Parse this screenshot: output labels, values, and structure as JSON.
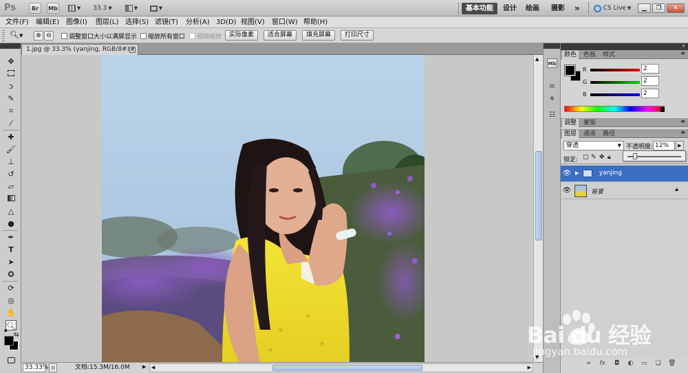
{
  "appbar": {
    "logo": "Ps",
    "buttons": [
      "Br",
      "Mb"
    ],
    "zoom": "33.3",
    "workspaces": [
      "基本功能",
      "设计",
      "绘画",
      "摄影"
    ],
    "more": "»",
    "cs_live": "CS Live"
  },
  "menu": [
    "文件(F)",
    "编辑(E)",
    "图像(I)",
    "图层(L)",
    "选择(S)",
    "滤镜(T)",
    "分析(A)",
    "3D(D)",
    "视图(V)",
    "窗口(W)",
    "帮助(H)"
  ],
  "options": {
    "chk_resize": "调整窗口大小以满屏显示",
    "chk_zoom_all": "缩放所有窗口",
    "chk_scrubby": "细微缩放",
    "btn_actual": "实际像素",
    "btn_fit": "适合屏幕",
    "btn_fill": "填充屏幕",
    "btn_print": "打印尺寸"
  },
  "document": {
    "tab_title": "1.jpg @ 33.3% (yanjing, RGB/8#) *",
    "zoom": "33.33%",
    "doc_info": "文档:15.3M/16.0M"
  },
  "color_panel": {
    "tabs": [
      "颜色",
      "色板",
      "样式"
    ],
    "r": "2",
    "g": "2",
    "b": "2",
    "labels": [
      "R",
      "G",
      "B"
    ]
  },
  "adjust_panel": {
    "tabs": [
      "调整",
      "蒙版"
    ]
  },
  "layers_panel": {
    "tabs": [
      "图层",
      "通道",
      "路径"
    ],
    "blend_mode": "穿透",
    "opacity_label": "不透明度:",
    "opacity_value": "12%",
    "lock_label": "锁定:",
    "layers": [
      {
        "name": "yanjing"
      },
      {
        "name": "背景"
      }
    ]
  },
  "watermark": {
    "brand": "Bai du 经验",
    "url": "jingyan.baidu.com"
  },
  "colors": {
    "accent": "#3a6fc4",
    "panel_bg": "#d4d4d4",
    "toolbar_bg": "#cdcdcd"
  }
}
